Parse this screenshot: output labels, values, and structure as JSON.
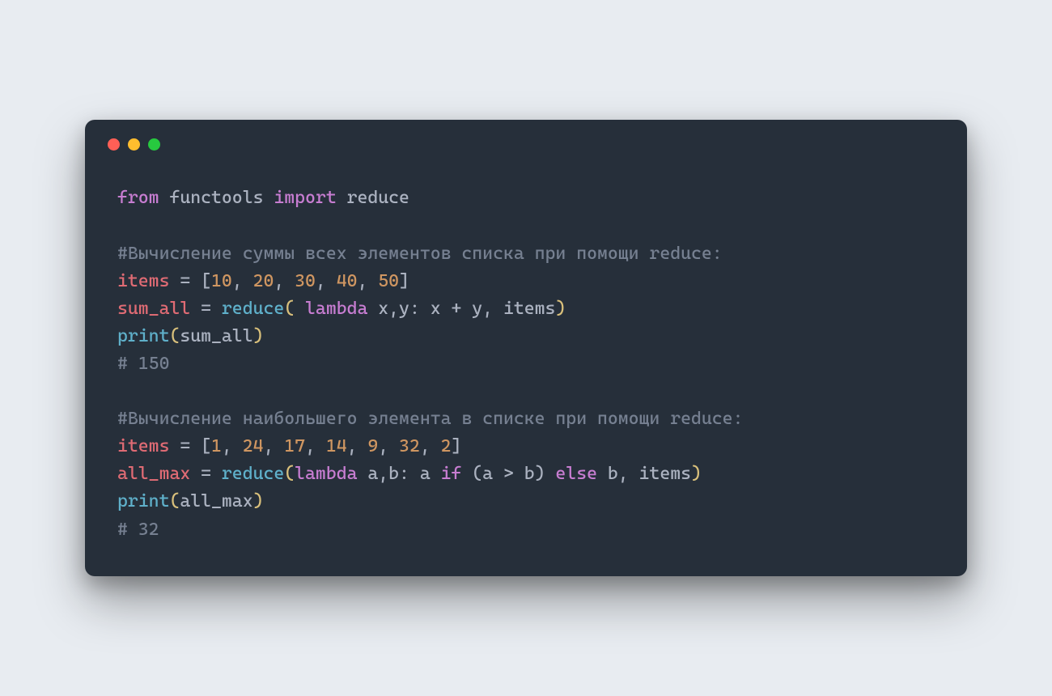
{
  "colors": {
    "background": "#e8ecf1",
    "window_bg": "#262f3a",
    "keyword": "#c77dd1",
    "identifier": "#abb2c0",
    "variable": "#df6b74",
    "number": "#cf9661",
    "function": "#5fb0ca",
    "comment": "#768091",
    "bracket_yellow": "#d9c07b",
    "dot_red": "#ff5f56",
    "dot_yellow": "#ffbd2e",
    "dot_green": "#27c93f"
  },
  "code": {
    "l1": {
      "from": "from",
      "sp1": " ",
      "mod": "functools",
      "sp2": " ",
      "import": "import",
      "sp3": " ",
      "name": "reduce"
    },
    "l2_blank": "",
    "l3_cmt": "#Вычисление суммы всех элементов списка при помощи reduce:",
    "l4": {
      "items": "items",
      "eq": " = [",
      "n1": "10",
      "c1": ", ",
      "n2": "20",
      "c2": ", ",
      "n3": "30",
      "c3": ", ",
      "n4": "40",
      "c4": ", ",
      "n5": "50",
      "close": "]"
    },
    "l5": {
      "sum_all": "sum_all",
      "eq": " = ",
      "reduce": "reduce",
      "open": "( ",
      "lambda": "lambda",
      "args": " x,y: x + y, items",
      "close": ")"
    },
    "l6": {
      "print": "print",
      "open": "(",
      "arg": "sum_all",
      "close": ")"
    },
    "l7_cmt": "# 150",
    "l8_blank": "",
    "l9_cmt": "#Вычисление наибольшего элемента в списке при помощи reduce:",
    "l10": {
      "items": "items",
      "eq": " = [",
      "n1": "1",
      "c1": ", ",
      "n2": "24",
      "c2": ", ",
      "n3": "17",
      "c3": ", ",
      "n4": "14",
      "c4": ", ",
      "n5": "9",
      "c5": ", ",
      "n6": "32",
      "c6": ", ",
      "n7": "2",
      "close": "]"
    },
    "l11": {
      "all_max": "all_max",
      "eq": " = ",
      "reduce": "reduce",
      "open": "(",
      "lambda": "lambda",
      "args1": " a,b: a ",
      "if": "if",
      "args2": " (a > b) ",
      "else": "else",
      "args3": " b, items",
      "close": ")"
    },
    "l12": {
      "print": "print",
      "open": "(",
      "arg": "all_max",
      "close": ")"
    },
    "l13_cmt": "# 32"
  }
}
